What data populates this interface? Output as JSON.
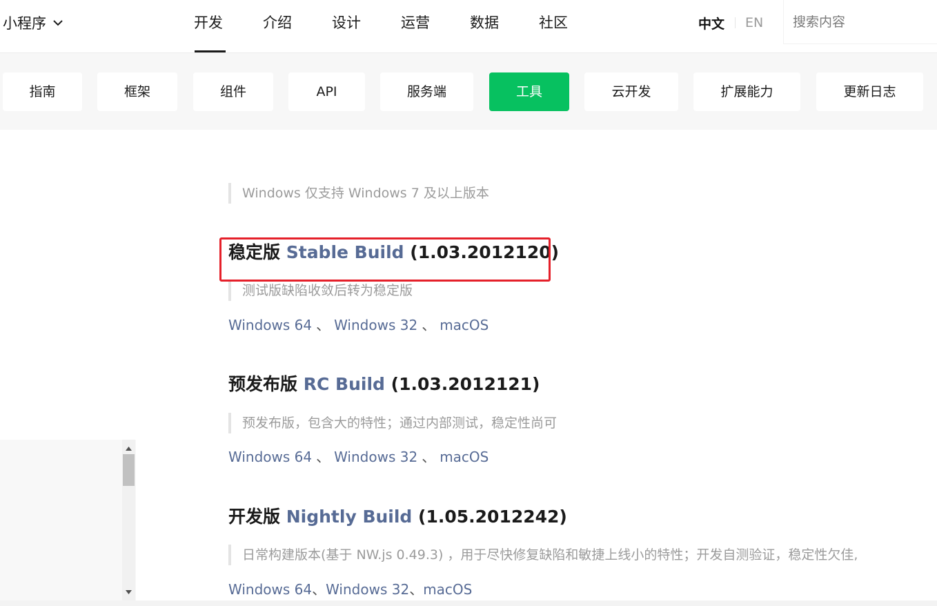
{
  "header": {
    "product_label": "小程序",
    "nav": [
      "开发",
      "介绍",
      "设计",
      "运营",
      "数据",
      "社区"
    ],
    "lang_cn": "中文",
    "lang_en": "EN",
    "search_placeholder": "搜索内容"
  },
  "subnav": {
    "items": [
      "指南",
      "框架",
      "组件",
      "API",
      "服务端",
      "工具",
      "云开发",
      "扩展能力",
      "更新日志"
    ],
    "active": "工具"
  },
  "content": {
    "intro_note": "Windows 仅支持 Windows 7 及以上版本",
    "builds": [
      {
        "label": "稳定版",
        "name": "Stable Build",
        "version": "(1.03.2012120)",
        "description": "测试版缺陷收敛后转为稳定版",
        "links": [
          "Windows 64",
          "Windows 32",
          "macOS"
        ]
      },
      {
        "label": "预发布版",
        "name": "RC Build",
        "version": "(1.03.2012121)",
        "description": "预发布版，包含大的特性；通过内部测试，稳定性尚可",
        "links": [
          "Windows 64",
          "Windows 32",
          "macOS"
        ]
      },
      {
        "label": "开发版",
        "name": "Nightly Build",
        "version": "(1.05.2012242)",
        "description": "日常构建版本(基于 NW.js 0.49.3) ，用于尽快修复缺陷和敏捷上线小的特性；开发自测验证，稳定性欠佳,",
        "links": [
          "Windows 64",
          "Windows 32",
          "macOS"
        ]
      }
    ],
    "separator": "、"
  },
  "colors": {
    "accent_green": "#07c160",
    "link_blue": "#576b95",
    "highlight_red": "#e5202a"
  }
}
